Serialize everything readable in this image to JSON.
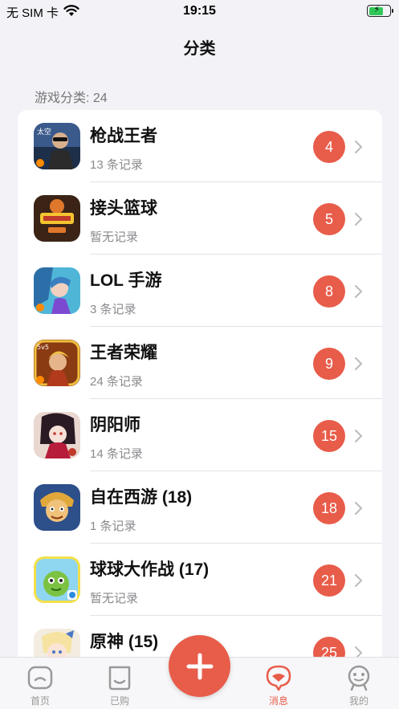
{
  "status_bar": {
    "carrier": "无 SIM 卡",
    "time": "19:15",
    "battery_level": 0.7
  },
  "nav": {
    "title": "分类"
  },
  "section": {
    "label": "游戏分类: 24"
  },
  "games": [
    {
      "name": "枪战王者",
      "records": "13 条记录",
      "count": "4",
      "icon": "cf-soldier-icon"
    },
    {
      "name": "接头篮球",
      "records": "暂无记录",
      "count": "5",
      "icon": "freestyle-basketball-icon"
    },
    {
      "name": "LOL 手游",
      "records": "3 条记录",
      "count": "8",
      "icon": "lol-jinx-icon"
    },
    {
      "name": "王者荣耀",
      "records": "24 条记录",
      "count": "9",
      "icon": "honor-of-kings-icon"
    },
    {
      "name": "阴阳师",
      "records": "14 条记录",
      "count": "15",
      "icon": "onmyoji-icon"
    },
    {
      "name": "自在西游 (18)",
      "records": "1 条记录",
      "count": "18",
      "icon": "journey-west-icon"
    },
    {
      "name": "球球大作战 (17)",
      "records": "暂无记录",
      "count": "21",
      "icon": "ball-battle-icon"
    },
    {
      "name": "原神 (15)",
      "records": "",
      "count": "25",
      "icon": "genshin-icon"
    }
  ],
  "tabs": [
    {
      "label": "首页",
      "icon": "home-icon",
      "active": false
    },
    {
      "label": "已购",
      "icon": "shopping-bag-icon",
      "active": false
    },
    {
      "label": "消息",
      "icon": "message-icon",
      "active": true
    },
    {
      "label": "我的",
      "icon": "profile-icon",
      "active": false
    }
  ],
  "colors": {
    "accent": "#e85c4a",
    "background": "#f2f2f7",
    "badge": "#e85c4a",
    "battery": "#32c759"
  }
}
